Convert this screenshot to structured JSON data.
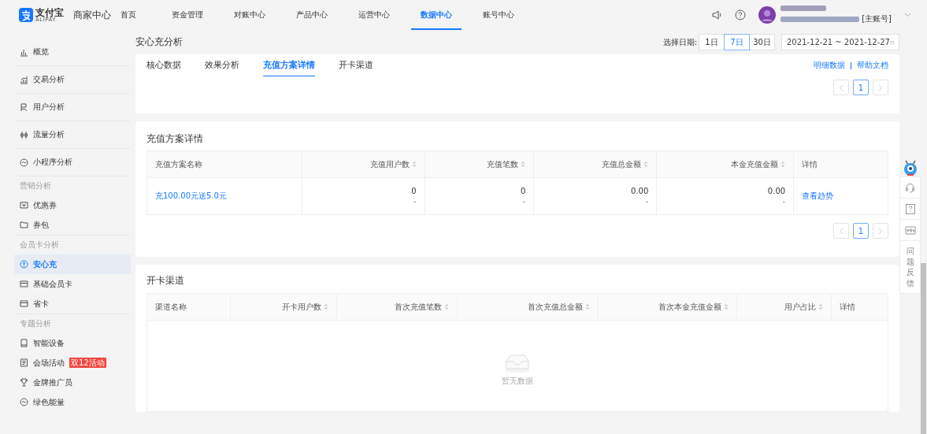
{
  "header": {
    "brand": "支付宝",
    "brand_sub": "ALIPAY",
    "product": "商家中心",
    "nav": [
      {
        "label": "首页",
        "selected": false
      },
      {
        "label": "资金管理",
        "selected": false
      },
      {
        "label": "对账中心",
        "selected": false
      },
      {
        "label": "产品中心",
        "selected": false
      },
      {
        "label": "运营中心",
        "selected": false
      },
      {
        "label": "数据中心",
        "selected": true
      },
      {
        "label": "账号中心",
        "selected": false
      }
    ],
    "account_tag": "[主账号]"
  },
  "sidebar": {
    "groups": [
      {
        "items": [
          {
            "label": "概览",
            "selected": false
          },
          {
            "label": "交易分析",
            "selected": false
          },
          {
            "label": "用户分析",
            "selected": false
          },
          {
            "label": "流量分析",
            "selected": false
          },
          {
            "label": "小程序分析",
            "selected": false
          }
        ]
      },
      {
        "heading": "营销分析",
        "items": [
          {
            "label": "优惠券",
            "selected": false
          },
          {
            "label": "券包",
            "selected": false
          }
        ]
      },
      {
        "heading": "会员卡分析",
        "items": [
          {
            "label": "安心充",
            "selected": true
          },
          {
            "label": "基础会员卡",
            "selected": false
          },
          {
            "label": "省卡",
            "selected": false
          }
        ]
      },
      {
        "heading": "专题分析",
        "items": [
          {
            "label": "智能设备",
            "selected": false
          },
          {
            "label": "会场活动",
            "selected": false,
            "badge": "双12活动"
          },
          {
            "label": "金牌推广员",
            "selected": false
          },
          {
            "label": "绿色能量",
            "selected": false
          }
        ]
      }
    ]
  },
  "page": {
    "title": "安心充分析",
    "date_label": "选择日期:",
    "ranges": [
      {
        "label": "1日",
        "selected": false
      },
      {
        "label": "7日",
        "selected": true
      },
      {
        "label": "30日",
        "selected": false
      }
    ],
    "date_range": "2021-12-21 ~ 2021-12-27"
  },
  "tabs": [
    {
      "label": "核心数据",
      "selected": false
    },
    {
      "label": "效果分析",
      "selected": false
    },
    {
      "label": "充值方案详情",
      "selected": true
    },
    {
      "label": "开卡渠道",
      "selected": false
    }
  ],
  "links": [
    "明细数据",
    "帮助文档"
  ],
  "top_pagination": {
    "page": "1"
  },
  "plans": {
    "title": "充值方案详情",
    "columns": [
      {
        "label": "充值方案名称",
        "sortable": false
      },
      {
        "label": "充值用户数",
        "sortable": true
      },
      {
        "label": "充值笔数",
        "sortable": true
      },
      {
        "label": "充值总金额",
        "sortable": true
      },
      {
        "label": "本金充值金额",
        "sortable": true
      },
      {
        "label": "详情",
        "sortable": false
      }
    ],
    "rows": [
      {
        "name": "充100.00元送5.0元",
        "cells": [
          {
            "value": "0",
            "sub": "-"
          },
          {
            "value": "0",
            "sub": "-"
          },
          {
            "value": "0.00",
            "sub": "-"
          },
          {
            "value": "0.00",
            "sub": "-"
          }
        ],
        "detail": "查看趋势"
      }
    ],
    "pagination": {
      "page": "1"
    }
  },
  "channels": {
    "title": "开卡渠道",
    "columns": [
      {
        "label": "渠道名称",
        "sortable": false
      },
      {
        "label": "开卡用户数",
        "sortable": true
      },
      {
        "label": "首次充值笔数",
        "sortable": true
      },
      {
        "label": "首次充值总金额",
        "sortable": true
      },
      {
        "label": "首次本金充值金额",
        "sortable": true
      },
      {
        "label": "用户占比",
        "sortable": true
      },
      {
        "label": "详情",
        "sortable": false
      }
    ],
    "empty_text": "暂无数据"
  },
  "float_tools": {
    "feedback": "问题反馈"
  }
}
